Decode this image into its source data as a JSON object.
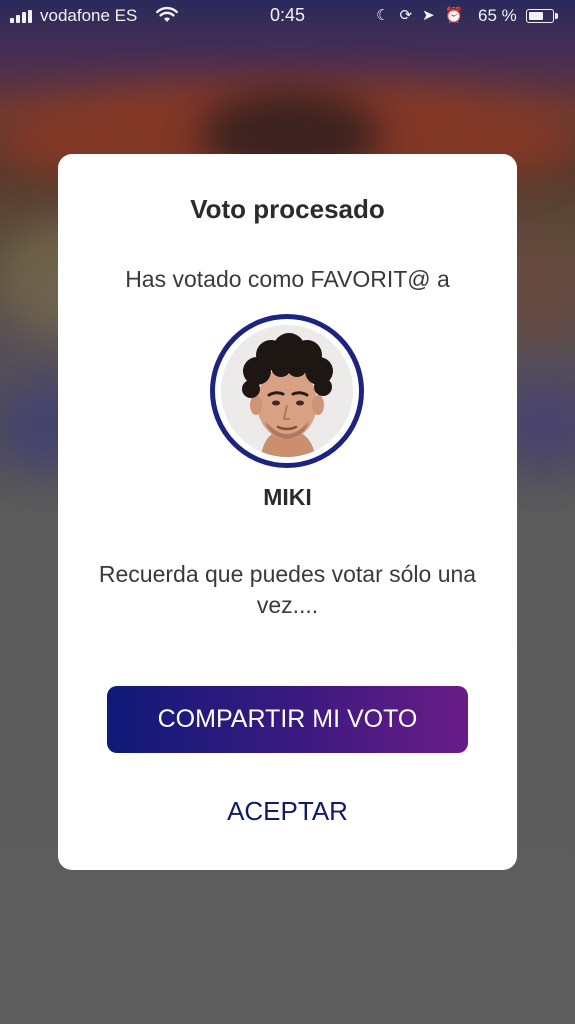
{
  "status_bar": {
    "carrier": "vodafone ES",
    "time": "0:45",
    "battery_percent": "65 %",
    "battery_level": 0.65,
    "icons": [
      "signal-icon",
      "wifi-icon",
      "moon-icon",
      "orientation-lock-icon",
      "location-icon",
      "alarm-icon",
      "battery-icon"
    ]
  },
  "dialog": {
    "title": "Voto procesado",
    "subtitle": "Has votado como FAVORIT@ a",
    "candidate_name": "MIKI",
    "note": "Recuerda que puedes votar sólo una vez....",
    "share_button": "COMPARTIR MI VOTO",
    "accept_button": "ACEPTAR"
  },
  "colors": {
    "ring": "#1c2480",
    "button_gradient_start": "#0e1a78",
    "button_gradient_end": "#6a1c86",
    "accept_text": "#101a6c"
  }
}
